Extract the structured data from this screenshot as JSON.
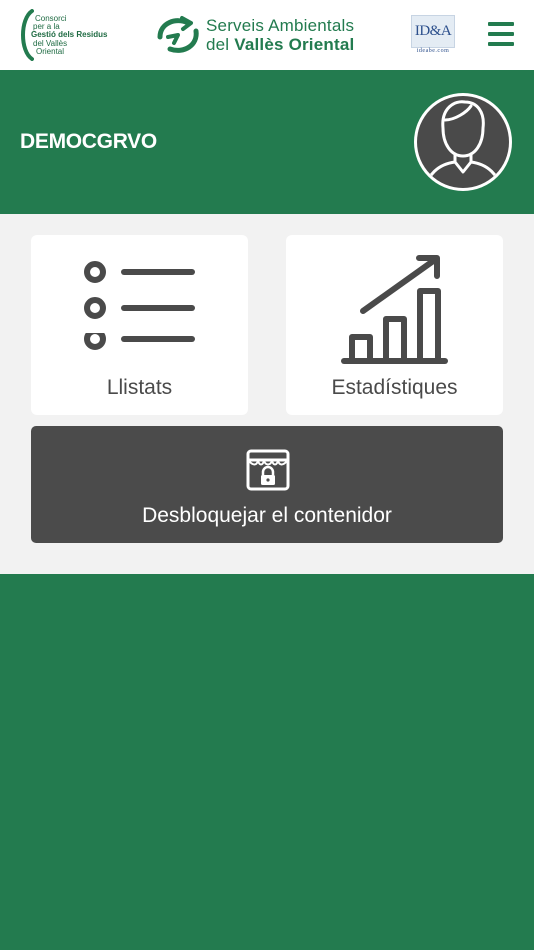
{
  "header": {
    "consorci_lines": [
      "Consorci",
      "per a la",
      "Gestió dels Residus",
      "del Vallès",
      "Oriental"
    ],
    "serveis_line1": "Serveis Ambientals",
    "serveis_line2_prefix": "del",
    "serveis_line2_bold": "Vallès Oriental",
    "ideabe_mark": "ID&A",
    "ideabe_caption": "ideabe.com"
  },
  "banner": {
    "username": "DEMOCGRVO"
  },
  "cards": {
    "llistats_label": "Llistats",
    "estadistiques_label": "Estadístiques"
  },
  "unlock": {
    "label": "Desbloquejar el contenidor"
  },
  "colors": {
    "brand_green": "#237b4f",
    "content_bg": "#f2f2f2",
    "dark_button": "#4b4b4b",
    "icon_gray": "#4a4a4a"
  }
}
